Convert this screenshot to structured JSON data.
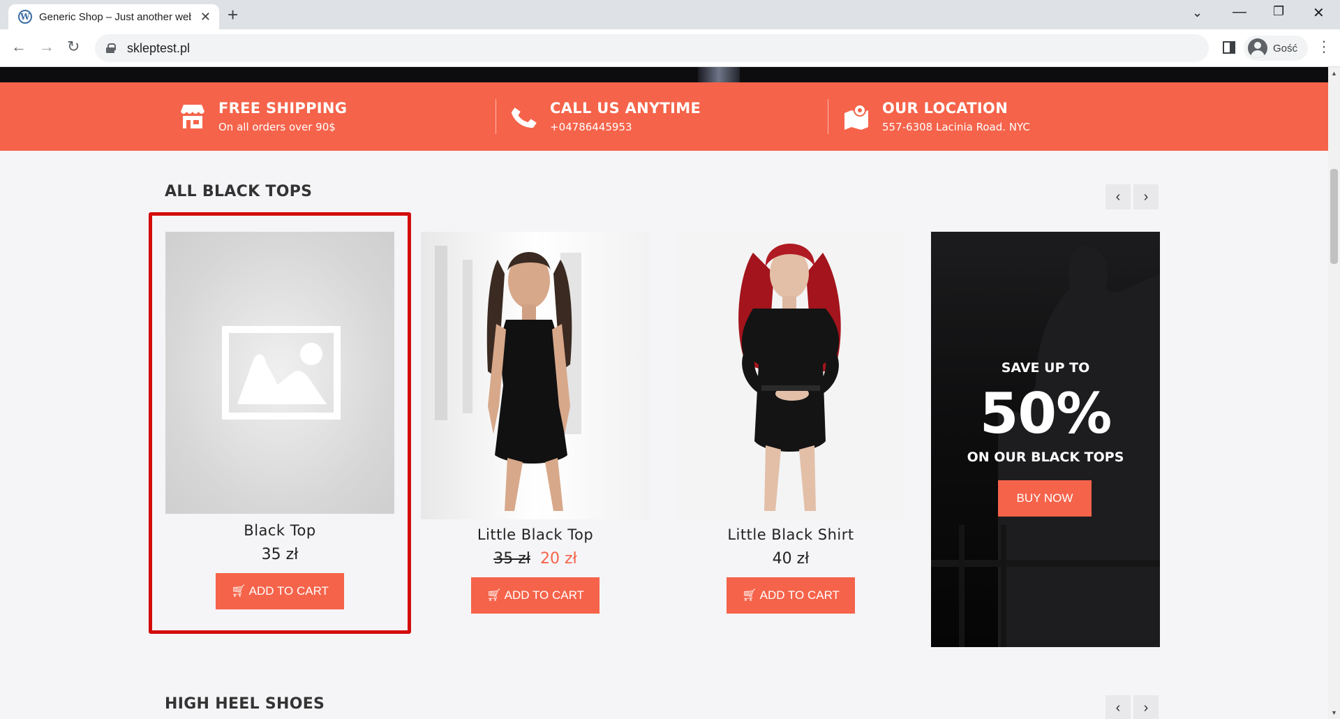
{
  "browser": {
    "tab_title": "Generic Shop – Just another web",
    "url": "skleptest.pl",
    "profile_name": "Gość"
  },
  "features": [
    {
      "icon": "store-icon",
      "title": "FREE SHIPPING",
      "subtitle": "On all orders over 90$"
    },
    {
      "icon": "phone-icon",
      "title": "CALL US ANYTIME",
      "subtitle": "+04786445953"
    },
    {
      "icon": "map-pin-icon",
      "title": "OUR LOCATION",
      "subtitle": "557-6308 Lacinia Road. NYC"
    }
  ],
  "section_black_tops": {
    "title": "ALL BLACK TOPS",
    "prev_glyph": "‹",
    "next_glyph": "›",
    "products": [
      {
        "name": "Black Top",
        "price": "35 zł",
        "button": "ADD TO CART"
      },
      {
        "name": "Little Black Top",
        "price_old": "35 zł",
        "price_new": "20 zł",
        "button": "ADD TO CART"
      },
      {
        "name": "Little Black Shirt",
        "price": "40 zł",
        "button": "ADD TO CART"
      }
    ],
    "promo": {
      "line1": "SAVE UP TO",
      "big": "50%",
      "line2": "ON OUR BLACK TOPS",
      "button": "BUY NOW"
    }
  },
  "section_high_heels": {
    "title": "HIGH HEEL SHOES"
  },
  "colors": {
    "accent": "#f5634a",
    "highlight": "#d40c0c"
  }
}
